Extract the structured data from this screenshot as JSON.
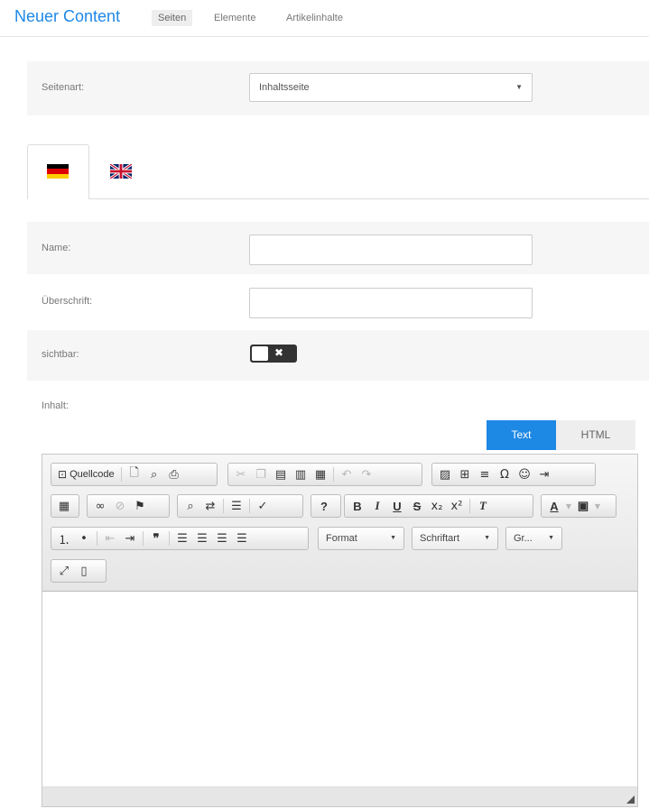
{
  "header": {
    "title": "Neuer Content",
    "tabs": [
      {
        "label": "Seiten",
        "active": true
      },
      {
        "label": "Elemente"
      },
      {
        "label": "Artikelinhalte"
      }
    ]
  },
  "page_type": {
    "label": "Seitenart:",
    "value": "Inhaltsseite"
  },
  "languages": [
    {
      "flag": "german-flag-icon",
      "active": true
    },
    {
      "flag": "uk-flag-icon"
    }
  ],
  "form": {
    "name_label": "Name:",
    "name_value": "",
    "heading_label": "Überschrift:",
    "heading_value": "",
    "visible_label": "sichtbar:",
    "visible_toggle": "✖",
    "content_label": "Inhalt:"
  },
  "editor": {
    "mode_text": "Text",
    "mode_html": "HTML",
    "source_label": "Quellcode",
    "format_label": "Format",
    "font_label": "Schriftart",
    "size_label": "Gr...",
    "content": ""
  },
  "colors": {
    "accent": "#1e88e5",
    "band": "#f6f6f6",
    "toggle": "#333333"
  }
}
